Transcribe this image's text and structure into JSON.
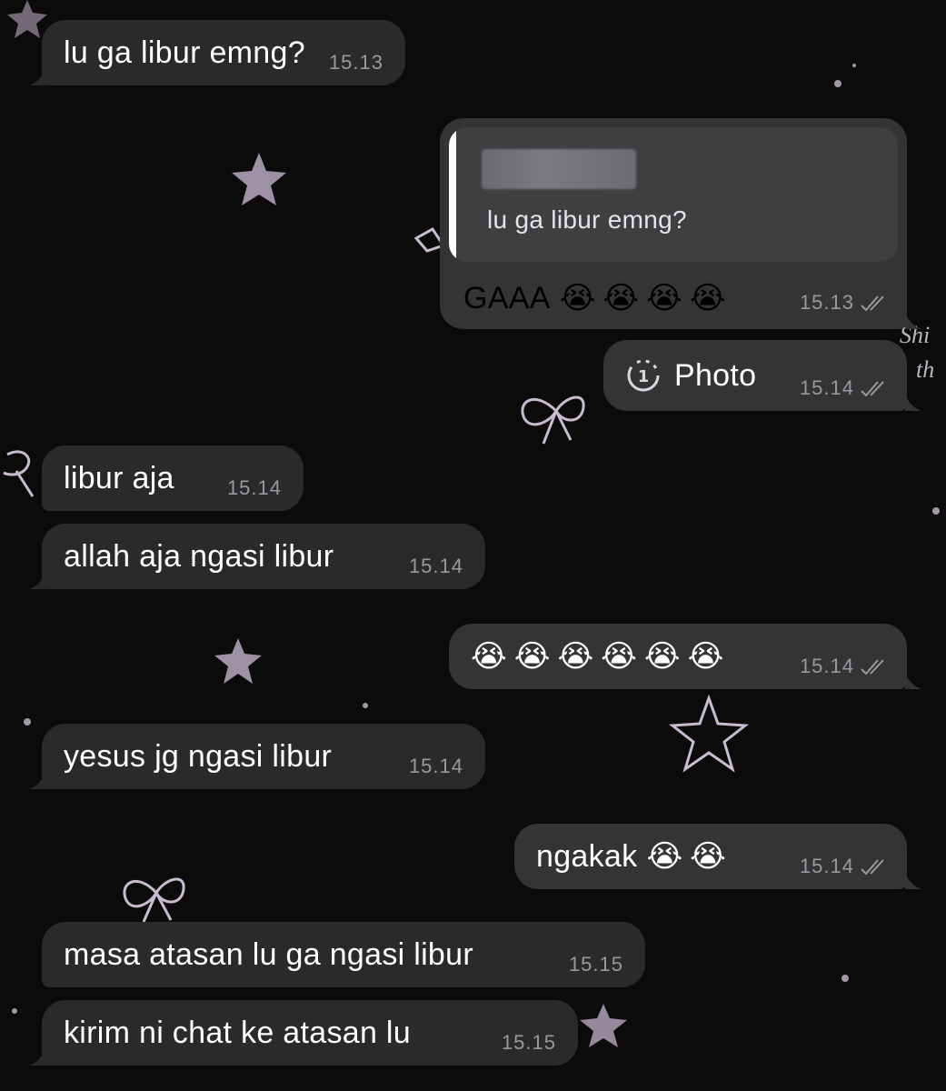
{
  "colors": {
    "background": "#0b0b0b",
    "incoming_bubble": "#2a2a2c",
    "outgoing_bubble": "#343436",
    "timestamp": "#9a9a9e",
    "wallpaper_decor": "#b9a9c2"
  },
  "messages": [
    {
      "direction": "incoming",
      "text": "lu ga libur emng?",
      "time": "15.13"
    },
    {
      "direction": "outgoing",
      "reply_to": {
        "sender": "[redacted]",
        "text": "lu ga libur emng?"
      },
      "text": "GAAA",
      "emoji": "😭😭😭😭",
      "time": "15.13",
      "status": "read"
    },
    {
      "direction": "outgoing",
      "icon": "view-once-icon",
      "text": "Photo",
      "time": "15.14",
      "status": "read"
    },
    {
      "direction": "incoming",
      "text": "libur aja",
      "time": "15.14"
    },
    {
      "direction": "incoming",
      "text": "allah aja ngasi libur",
      "time": "15.14"
    },
    {
      "direction": "outgoing",
      "emoji": "😭😭😭😭😭😭",
      "time": "15.14",
      "status": "read"
    },
    {
      "direction": "incoming",
      "text": "yesus jg ngasi libur",
      "time": "15.14"
    },
    {
      "direction": "outgoing",
      "text": "ngakak",
      "emoji": "😭😭",
      "time": "15.14",
      "status": "read"
    },
    {
      "direction": "incoming",
      "text": "masa atasan lu ga ngasi libur",
      "time": "15.15"
    },
    {
      "direction": "incoming",
      "text": "kirim ni chat ke atasan lu",
      "time": "15.15"
    }
  ],
  "wallpaper_text": [
    "Shi",
    "th"
  ]
}
